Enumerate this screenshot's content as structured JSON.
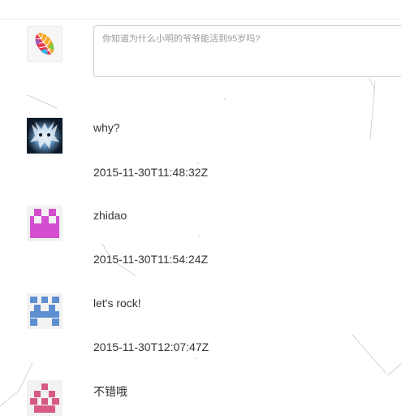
{
  "comment_input": {
    "placeholder": "你知道为什么小明的爷爷能活到95岁吗?",
    "value": ""
  },
  "current_user": {
    "avatar_icon": "rainbow-leaf-icon"
  },
  "comments": [
    {
      "text": "why?",
      "timestamp": "2015-11-30T11:48:32Z",
      "avatar_icon": "dark-creature-avatar-icon"
    },
    {
      "text": "zhidao",
      "timestamp": "2015-11-30T11:54:24Z",
      "avatar_icon": "magenta-identicon",
      "avatar_color": "#d44fcf"
    },
    {
      "text": "let's rock!",
      "timestamp": "2015-11-30T12:07:47Z",
      "avatar_icon": "blue-identicon",
      "avatar_color": "#5d8fd1"
    },
    {
      "text": "不错哦",
      "timestamp": "",
      "avatar_icon": "pink-identicon",
      "avatar_color": "#d75a86"
    }
  ]
}
